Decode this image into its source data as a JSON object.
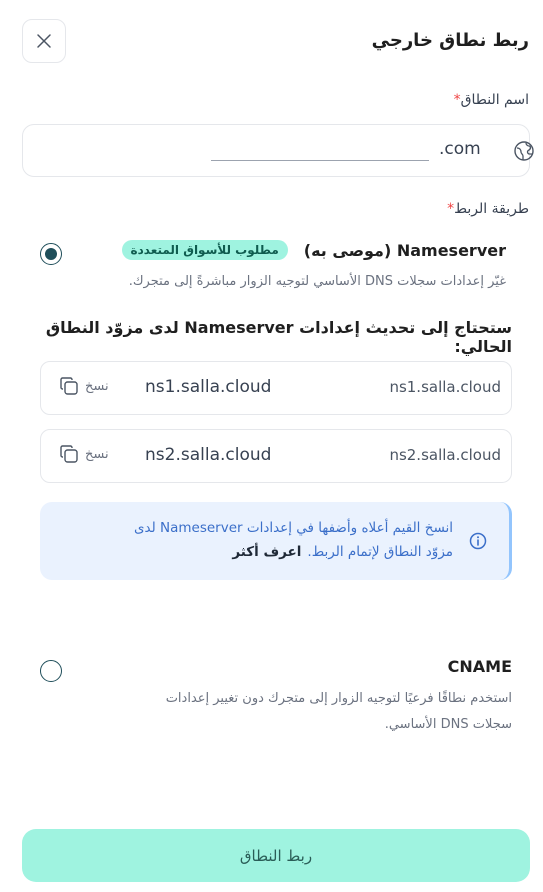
{
  "header": {
    "title": "ربط نطاق خارجي"
  },
  "domain": {
    "label": "اسم النطاق",
    "required_mark": "*",
    "suffix": ".com",
    "value": ""
  },
  "method": {
    "label": "طريقة الربط",
    "required_mark": "*",
    "options": [
      {
        "title": "Nameserver (موصى به)",
        "badge": "مطلوب للأسواق المتعددة",
        "description": "غيّر إعدادات سجلات DNS الأساسي لتوجيه الزوار مباشرةً إلى متجرك.",
        "selected": true
      },
      {
        "title": "CNAME",
        "description_line1": "استخدم نطاقًا فرعيًا لتوجيه الزوار إلى متجرك دون تغيير إعدادات",
        "description_line2": "سجلات DNS الأساسي.",
        "selected": false
      }
    ]
  },
  "nameservers": {
    "heading": "ستحتاج إلى تحديث إعدادات Nameserver لدى مزوّد النطاق الحالي:",
    "copy_label": "نسخ",
    "items": [
      {
        "label": "ns1.salla.cloud",
        "value": "ns1.salla.cloud"
      },
      {
        "label": "ns2.salla.cloud",
        "value": "ns2.salla.cloud"
      }
    ]
  },
  "info": {
    "line1": "انسخ القيم أعلاه وأضفها في إعدادات Nameserver لدى",
    "line2": "مزوّد النطاق لإتمام الربط.",
    "link": "اعرف أكثر"
  },
  "submit_label": "ربط النطاق",
  "colors": {
    "accent": "#9ff3e0",
    "accent_text": "#0f5c4f",
    "radio": "#1f4e5a",
    "info_bg": "#eaf2fe",
    "info_text": "#3b6fc9",
    "required": "#ef4444"
  },
  "icons": {
    "close": "close-icon",
    "globe": "globe-icon",
    "copy": "copy-icon",
    "info": "info-icon"
  }
}
